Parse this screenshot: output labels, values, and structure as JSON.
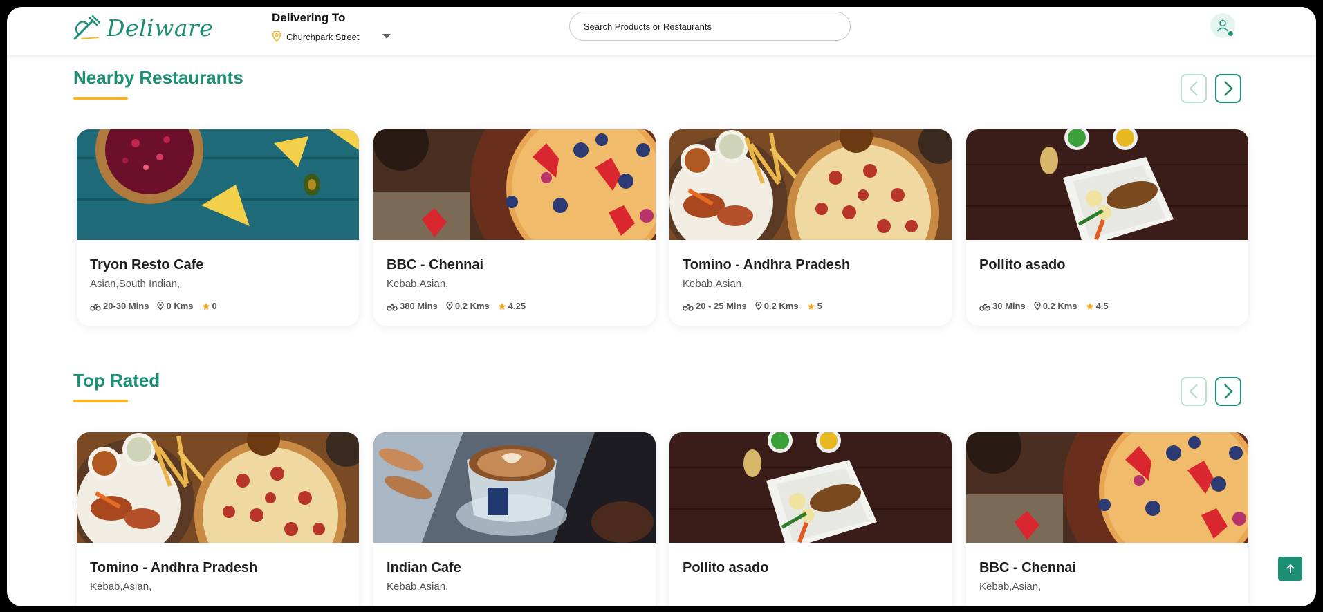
{
  "header": {
    "logo_text": "Deliware",
    "delivering_label": "Delivering To",
    "location": "Churchpark Street",
    "search_placeholder": "Search Products or Restaurants"
  },
  "sections": [
    {
      "title": "Nearby Restaurants",
      "cards": [
        {
          "name": "Tryon Resto Cafe",
          "cuisine": "Asian,South Indian,",
          "time": "20-30 Mins",
          "distance": "0 Kms",
          "rating": "0",
          "image": "salsa-nachos"
        },
        {
          "name": "BBC - Chennai",
          "cuisine": "Kebab,Asian,",
          "time": "380 Mins",
          "distance": "0.2 Kms",
          "rating": "4.25",
          "image": "berry-pancake"
        },
        {
          "name": "Tomino - Andhra Pradesh",
          "cuisine": "Kebab,Asian,",
          "time": "20 - 25 Mins",
          "distance": "0.2 Kms",
          "rating": "5",
          "image": "pizza-wings"
        },
        {
          "name": "Pollito asado",
          "cuisine": "",
          "time": "30 Mins",
          "distance": "0.2 Kms",
          "rating": "4.5",
          "image": "grilled-chicken-plate"
        }
      ]
    },
    {
      "title": "Top Rated",
      "cards": [
        {
          "name": "Tomino - Andhra Pradesh",
          "cuisine": "Kebab,Asian,",
          "image": "pizza-wings"
        },
        {
          "name": "Indian Cafe",
          "cuisine": "Kebab,Asian,",
          "image": "coffee-latte"
        },
        {
          "name": "Pollito asado",
          "cuisine": "",
          "image": "grilled-chicken-plate"
        },
        {
          "name": "BBC - Chennai",
          "cuisine": "Kebab,Asian,",
          "image": "berry-pancake"
        }
      ]
    }
  ],
  "colors": {
    "brand": "#1d8f74",
    "accent": "#f5b42a",
    "star": "#f5a623"
  },
  "icons": [
    "logo-icon",
    "location-pin-icon",
    "caret-down-icon",
    "user-icon",
    "chevron-left-icon",
    "chevron-right-icon",
    "delivery-time-icon",
    "distance-pin-icon",
    "star-icon",
    "arrow-up-icon"
  ]
}
